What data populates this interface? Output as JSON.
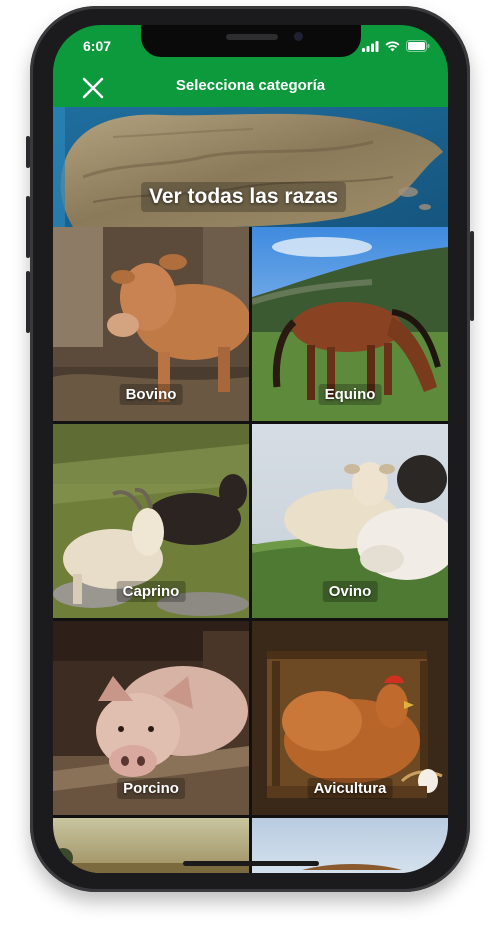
{
  "status_bar": {
    "time": "6:07",
    "icons": [
      "signal-icon",
      "wifi-icon",
      "battery-icon"
    ]
  },
  "header": {
    "title": "Selecciona categoría",
    "close_icon": "close-icon",
    "background": "#0c9a3d"
  },
  "banner": {
    "label": "Ver todas las razas"
  },
  "categories": [
    {
      "label": "Bovino"
    },
    {
      "label": "Equino"
    },
    {
      "label": "Caprino"
    },
    {
      "label": "Ovino"
    },
    {
      "label": "Porcino"
    },
    {
      "label": "Avicultura"
    }
  ]
}
